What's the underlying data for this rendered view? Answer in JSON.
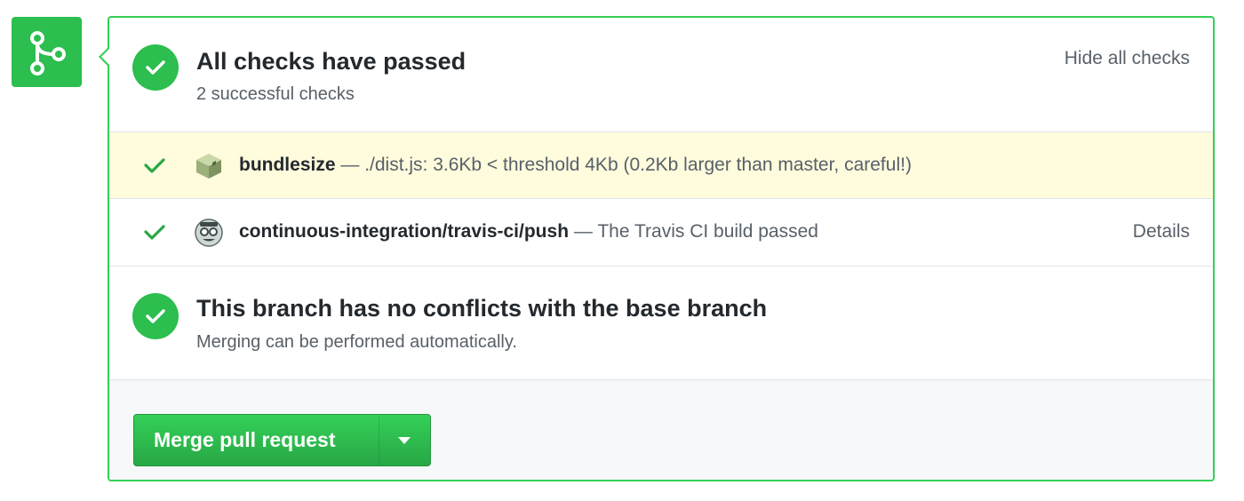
{
  "status": {
    "title": "All checks have passed",
    "subtitle": "2 successful checks",
    "toggle_label": "Hide all checks"
  },
  "checks": [
    {
      "context": "bundlesize",
      "separator": " — ",
      "description": "./dist.js: 3.6Kb < threshold 4Kb (0.2Kb larger than master, careful!)",
      "avatar_icon": "package-box-icon",
      "details_label": ""
    },
    {
      "context": "continuous-integration/travis-ci/push",
      "separator": " — ",
      "description": "The Travis CI build passed",
      "avatar_icon": "travis-mascot-icon",
      "details_label": "Details"
    }
  ],
  "mergeability": {
    "title": "This branch has no conflicts with the base branch",
    "subtitle": "Merging can be performed automatically."
  },
  "merge": {
    "button_label": "Merge pull request"
  },
  "colors": {
    "success_green": "#2cbe4e",
    "border_green": "#34d058",
    "highlight_yellow": "#fffbdd",
    "muted_text": "#586069"
  }
}
